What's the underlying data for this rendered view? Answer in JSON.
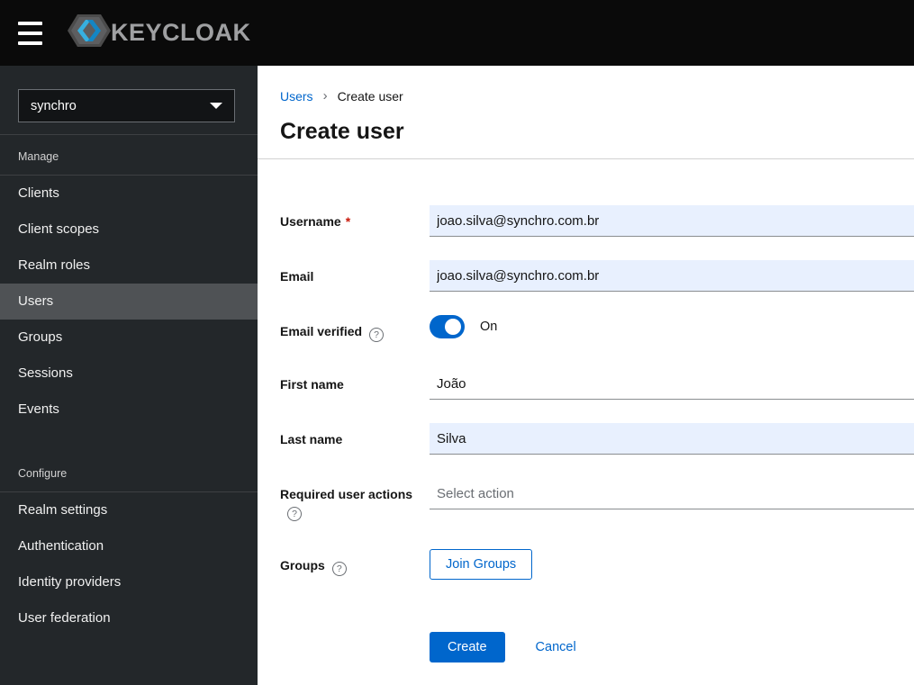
{
  "topbar": {
    "brand_text": "KEYCLOAK"
  },
  "sidebar": {
    "realm_selector": {
      "value": "synchro"
    },
    "sections": [
      {
        "label": "Manage",
        "items": [
          {
            "label": "Clients",
            "active": false
          },
          {
            "label": "Client scopes",
            "active": false
          },
          {
            "label": "Realm roles",
            "active": false
          },
          {
            "label": "Users",
            "active": true
          },
          {
            "label": "Groups",
            "active": false
          },
          {
            "label": "Sessions",
            "active": false
          },
          {
            "label": "Events",
            "active": false
          }
        ]
      },
      {
        "label": "Configure",
        "items": [
          {
            "label": "Realm settings",
            "active": false
          },
          {
            "label": "Authentication",
            "active": false
          },
          {
            "label": "Identity providers",
            "active": false
          },
          {
            "label": "User federation",
            "active": false
          }
        ]
      }
    ]
  },
  "main": {
    "breadcrumb": {
      "link": "Users",
      "current": "Create user"
    },
    "title": "Create user",
    "form": {
      "username": {
        "label": "Username",
        "required_marker": "*",
        "value": "joao.silva@synchro.com.br"
      },
      "email": {
        "label": "Email",
        "value": "joao.silva@synchro.com.br"
      },
      "email_verified": {
        "label": "Email verified",
        "state_label": "On",
        "state": "on"
      },
      "first_name": {
        "label": "First name",
        "value": "João"
      },
      "last_name": {
        "label": "Last name",
        "value": "Silva"
      },
      "required_user_actions": {
        "label": "Required user actions",
        "placeholder": "Select action"
      },
      "groups": {
        "label": "Groups",
        "button_label": "Join Groups"
      },
      "actions": {
        "create_label": "Create",
        "cancel_label": "Cancel"
      }
    }
  },
  "icons": {
    "help_glyph": "?",
    "breadcrumb_separator": "›"
  },
  "colors": {
    "accent_blue": "#0066cc",
    "autofill_input_bg": "#e8f0fe",
    "required_red": "#c9190b",
    "sidebar_bg": "#23272a",
    "sidebar_active_bg": "#4f5255",
    "topbar_bg": "#0a0a0a"
  }
}
